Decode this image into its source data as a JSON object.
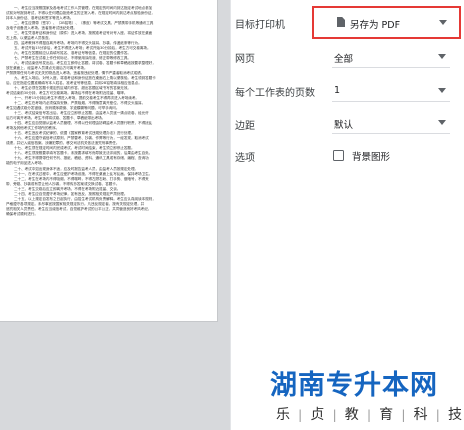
{
  "preview": {
    "lines": [
      "一、考生应当按照国家及各地考试工作人员管理，在规定的时间内到达指定考试地点参加",
      "试前对号报到考试，不得以任何理由拒绝考生的正常入考。在规定时间内到达考点核验身份证，",
      "持本人身份证、准考证和签字等进入考场。",
      "二、考生应携带（签字）、（2B铅笔）、（橡皮）等考试文具，严禁携带手机等通讯工具",
      "及电子设备进入考场。违者按考试违纪处理。",
      "三、考生凭准考证和身份证（原件）进入考场，按照准考证号对号入座，将证件放在桌面",
      "右上角，以便监考人员核查。",
      "四、监考教师不得擅自离开考场，考场内不得交头接耳、抄袭、传递纸条等行为。",
      "五、考试开始15分钟后，考生不得进入考场；考试开始30分钟后，考生方可交卷离场。",
      "六、考生在答题前应认真填写姓名、准考证号等信息，在规定的位置作答。",
      "七、严禁考生在试卷上作任何标记，不得使用涂改液、修正带等修改工具。",
      "八、考试结束信号发出后，考生应立即停止答题，将试卷、答题卡和草稿纸按要求整理好，",
      "放在桌面上，经监考人员清点无误后方可离开考场。",
      "严禁携带任何与考试无关的物品进入考场，违者按违纪处理，情节严重者取消考试成绩。",
      "九、考生入场后，对号入座，将准考证和身份证放在桌面右上角以便核验。考生领到答题卡",
      "后，应在指定位置准确填写本人姓名、准考证号等信息，并用2B铅笔填涂相应信息点。",
      "十、考生必须在答题卡规定的区域内作答，超出答题区域书写的答案无效。",
      "考试结束前30分钟，考生方可交卷离场。离场后不得在考场附近逗留、喧哗。",
      "十一、开考15分钟后考生不得进入考场，提前交卷考生不得再次进入考场续考。",
      "十二、考生在考场内必须保持安静，严禁吸烟，不得随意离开座位，不得交头接耳。",
      "考生如遇试卷分发错误、页码顺序颠倒、字迹模糊等问题，可举手询问。",
      "十三、考试结束信号发出后，考生应立即停止答题，由监考人员逐一清点收卷，经允许",
      "后方可离开考场。考生不得将试卷、答题卡、草稿纸带出考场。",
      "十四、考生应自觉服从监考人员管理，不得以任何理由妨碍监考人员履行职责，不得扰乱",
      "考场及其他考试工作场所的秩序。",
      "十五、考生违反考试纪律的，依据《国家教育考试违规处理办法》进行处理。",
      "十六、考生应遵守诚信考试原则，严禁替考、抄袭、作弊等行为，一经发现，取消考试",
      "成绩，并记入诚信档案。涉嫌犯罪的，移交司法机关依法追究刑事责任。",
      "十七、考生须在规定时间内完成考试，考试时间结束，考生须立即停止答题。",
      "十八、考生须按照要求填写答题卡，未按要求填写而导致无法评阅的，后果由考生自负。",
      "十九、考生不得携带任何书刊、报纸、稿纸、资料、通讯工具或有存储、编程、查询功",
      "能的电子用品进入考场。",
      "二十、考试中如出现身体不适，应及时报告监考人员，由监考人员按规定处理。",
      "二十一、在考试过程中，考生应爱护考场设施，不得在桌面上乱写乱画，保持考场卫生。",
      "二十二、考生在考场内不得吸烟，不得喧哗，不得左顾右盼、打手势、做暗号，不得夹",
      "带、旁窥、抄袭或有意让他人抄袭，不得传抄答案或交换试卷、答题卡。",
      "二十三、考生交卷后应立即离开考场，不得在考场附近逗留、交谈。",
      "二十四、考生应自觉遵守考场纪律，如有违反，按照相关规定严肃处理。",
      "二十五、以上规定自发布之日起执行，由招生考试机构负责解释。考生应认真阅读本规则，",
      "严格遵守各项规定。未尽事宜按国家相关规定执行。凡违反规定者，按有关规定处理，并",
      "追究相关人员责任。考生应当诚信考试，自觉维护考试的公平公正，共同营造良好考风考纪，",
      "确保考试顺利进行。"
    ]
  },
  "settings": {
    "destination": {
      "label": "目标打印机",
      "value": "另存为 PDF"
    },
    "pages": {
      "label": "网页",
      "value": "全部"
    },
    "pages_per_sheet": {
      "label": "每个工作表的页数",
      "value": "1"
    },
    "margins": {
      "label": "边距",
      "value": "默认"
    },
    "options": {
      "label": "选项",
      "background_graphics": "背景图形",
      "background_graphics_checked": false
    }
  },
  "watermark": {
    "title": "湖南专升本网",
    "subtitle": [
      "乐",
      "贞",
      "教",
      "育",
      "科",
      "技"
    ]
  }
}
